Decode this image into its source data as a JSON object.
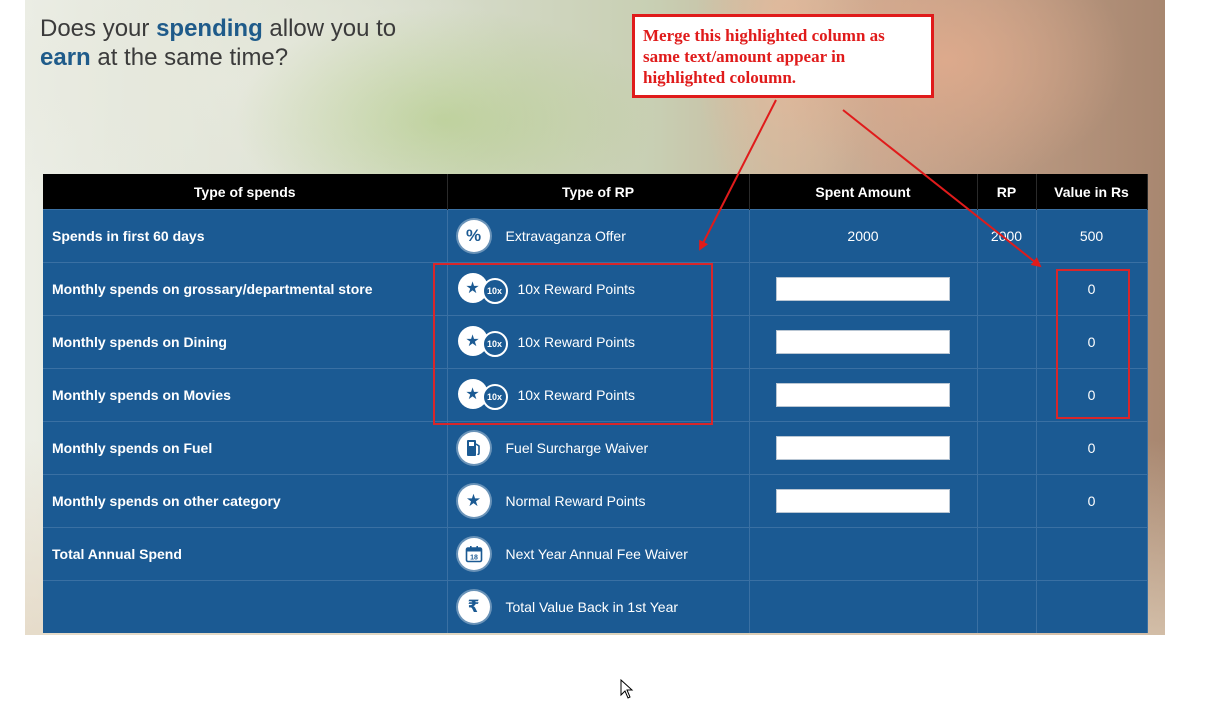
{
  "headline": {
    "part1": "Does your ",
    "spending": "spending",
    "part2": " allow you to",
    "earn": "earn",
    "part3": " at the same time?"
  },
  "annotation": {
    "text": "Merge this highlighted  column as same text/amount appear in highlighted coloumn."
  },
  "table": {
    "headers": [
      "Type of spends",
      "Type of RP",
      "Spent Amount",
      "RP",
      "Value in Rs"
    ],
    "rows": [
      {
        "spend": "Spends in first 60 days",
        "icon": "percent-icon",
        "rp_type": "Extravaganza Offer",
        "amount": "2000",
        "rp": "2000",
        "value": "500"
      },
      {
        "spend": "Monthly spends on grossary/departmental store",
        "icon": "10x-reward-icon",
        "rp_type": "10x Reward Points",
        "amount": "",
        "rp": "",
        "value": "0"
      },
      {
        "spend": "Monthly spends on Dining",
        "icon": "10x-reward-icon",
        "rp_type": "10x Reward Points",
        "amount": "",
        "rp": "",
        "value": "0"
      },
      {
        "spend": "Monthly spends on Movies",
        "icon": "10x-reward-icon",
        "rp_type": "10x Reward Points",
        "amount": "",
        "rp": "",
        "value": "0"
      },
      {
        "spend": "Monthly spends on Fuel",
        "icon": "fuel-pump-icon",
        "rp_type": "Fuel Surcharge Waiver",
        "amount": "",
        "rp": "",
        "value": "0"
      },
      {
        "spend": "Monthly spends on other category",
        "icon": "star-icon",
        "rp_type": "Normal Reward Points",
        "amount": "",
        "rp": "",
        "value": "0"
      },
      {
        "spend": "Total Annual Spend",
        "icon": "calendar-icon",
        "rp_type": "Next Year Annual Fee Waiver",
        "amount": "",
        "rp": "",
        "value": ""
      },
      {
        "spend": "",
        "icon": "rupee-icon",
        "rp_type": "Total Value Back in 1st Year",
        "amount": "",
        "rp": "",
        "value": ""
      }
    ],
    "badge_10x": "10x"
  },
  "colors": {
    "table_body": "#1b5a93",
    "header": "#000000",
    "annotation_red": "#e01b1b",
    "headline_accent": "#1f5b8a"
  }
}
